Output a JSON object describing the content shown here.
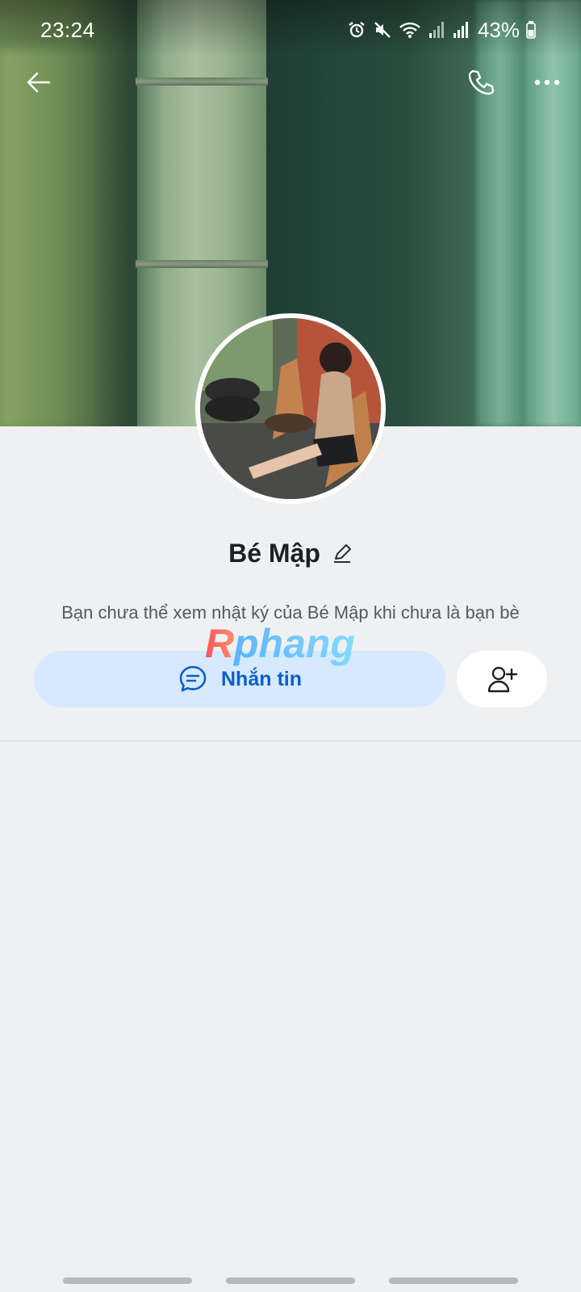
{
  "status_bar": {
    "time": "23:24",
    "battery": "43%"
  },
  "header": {
    "back_icon": "arrow-left-icon",
    "call_icon": "phone-icon",
    "more_icon": "more-horizontal-icon"
  },
  "profile": {
    "name": "Bé Mập",
    "notice": "Bạn chưa thể xem nhật ký của Bé Mập khi chưa là bạn bè"
  },
  "actions": {
    "message_label": "Nhắn tin",
    "message_icon": "chat-bubble-icon",
    "add_friend_icon": "add-user-icon"
  },
  "watermark": {
    "text": "Rphang"
  },
  "colors": {
    "accent": "#0b5fcc",
    "message_button_bg": "#d6e9fe",
    "page_bg": "#eef0f2"
  }
}
